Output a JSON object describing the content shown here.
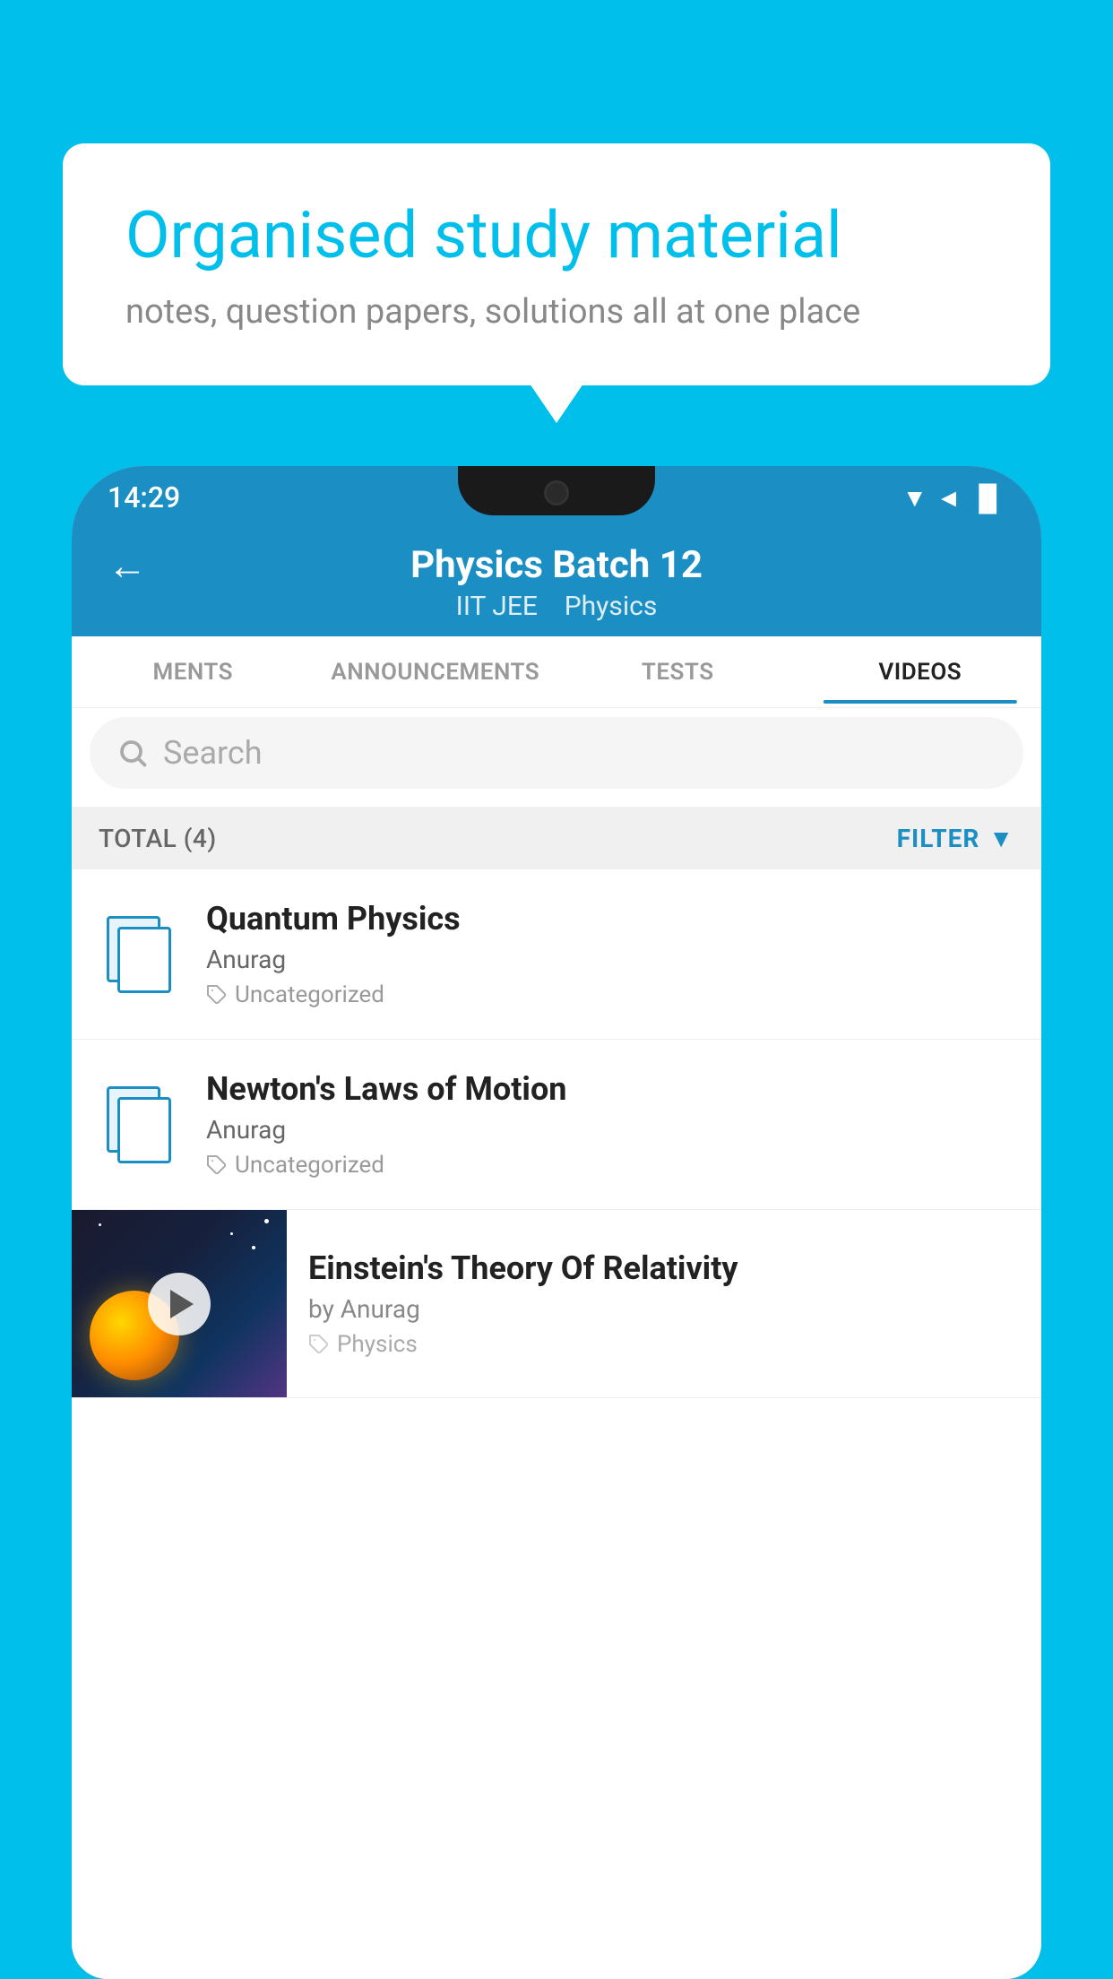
{
  "background_color": "#00BFEA",
  "speech_bubble": {
    "title": "Organised study material",
    "subtitle": "notes, question papers, solutions all at one place"
  },
  "status_bar": {
    "time": "14:29",
    "icons": "▼◄▐"
  },
  "app_header": {
    "back_label": "←",
    "title": "Physics Batch 12",
    "subtitle_parts": [
      "IIT JEE",
      "Physics"
    ]
  },
  "tabs": [
    {
      "label": "MENTS",
      "active": false
    },
    {
      "label": "ANNOUNCEMENTS",
      "active": false
    },
    {
      "label": "TESTS",
      "active": false
    },
    {
      "label": "VIDEOS",
      "active": true
    }
  ],
  "search": {
    "placeholder": "Search"
  },
  "filter_row": {
    "total_label": "TOTAL (4)",
    "filter_label": "FILTER"
  },
  "video_items": [
    {
      "type": "doc",
      "title": "Quantum Physics",
      "author": "Anurag",
      "tag": "Uncategorized"
    },
    {
      "type": "doc",
      "title": "Newton's Laws of Motion",
      "author": "Anurag",
      "tag": "Uncategorized"
    },
    {
      "type": "thumb",
      "title": "Einstein's Theory Of Relativity",
      "author": "by Anurag",
      "tag": "Physics"
    }
  ]
}
